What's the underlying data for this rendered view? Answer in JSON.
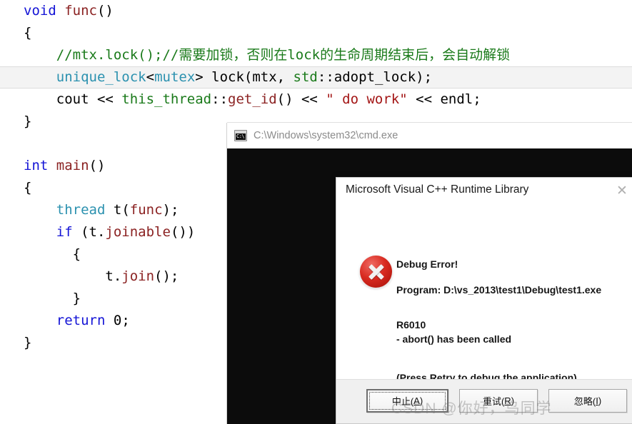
{
  "editor": {
    "name": "code-editor",
    "language": "cpp",
    "lines": [
      {
        "indent": 0,
        "highlighted": false,
        "tokens": [
          {
            "t": "void",
            "c": "kw"
          },
          {
            "t": " ",
            "c": "pl"
          },
          {
            "t": "func",
            "c": "fn"
          },
          {
            "t": "()",
            "c": "pl"
          }
        ]
      },
      {
        "indent": 0,
        "highlighted": false,
        "tokens": [
          {
            "t": "{",
            "c": "pl"
          }
        ]
      },
      {
        "indent": 1,
        "highlighted": false,
        "tokens": [
          {
            "t": "//mtx.lock();//需要加锁，否则在lock的生命周期结束后，会自动解锁",
            "c": "cm"
          }
        ]
      },
      {
        "indent": 1,
        "highlighted": true,
        "tokens": [
          {
            "t": "unique_lock",
            "c": "ty"
          },
          {
            "t": "<",
            "c": "pl"
          },
          {
            "t": "mutex",
            "c": "ty"
          },
          {
            "t": "> lock(mtx, ",
            "c": "pl"
          },
          {
            "t": "std",
            "c": "ns"
          },
          {
            "t": "::adopt_lock);",
            "c": "pl"
          }
        ]
      },
      {
        "indent": 1,
        "highlighted": false,
        "tokens": [
          {
            "t": "cout << ",
            "c": "pl"
          },
          {
            "t": "this_thread",
            "c": "cm"
          },
          {
            "t": "::",
            "c": "pl"
          },
          {
            "t": "get_id",
            "c": "fn"
          },
          {
            "t": "() << ",
            "c": "pl"
          },
          {
            "t": "\" do work\"",
            "c": "st"
          },
          {
            "t": " << endl;",
            "c": "pl"
          }
        ]
      },
      {
        "indent": 0,
        "highlighted": false,
        "tokens": [
          {
            "t": "}",
            "c": "pl"
          }
        ]
      },
      {
        "indent": 0,
        "highlighted": false,
        "tokens": [
          {
            "t": "",
            "c": "pl"
          }
        ]
      },
      {
        "indent": 0,
        "highlighted": false,
        "tokens": [
          {
            "t": "int",
            "c": "kw"
          },
          {
            "t": " ",
            "c": "pl"
          },
          {
            "t": "main",
            "c": "fn"
          },
          {
            "t": "()",
            "c": "pl"
          }
        ]
      },
      {
        "indent": 0,
        "highlighted": false,
        "tokens": [
          {
            "t": "{",
            "c": "pl"
          }
        ]
      },
      {
        "indent": 1,
        "highlighted": false,
        "tokens": [
          {
            "t": "thread",
            "c": "ty"
          },
          {
            "t": " ",
            "c": "pl"
          },
          {
            "t": "t",
            "c": "pl"
          },
          {
            "t": "(",
            "c": "pl"
          },
          {
            "t": "func",
            "c": "fn"
          },
          {
            "t": ");",
            "c": "pl"
          }
        ]
      },
      {
        "indent": 1,
        "highlighted": false,
        "tokens": [
          {
            "t": "if",
            "c": "kw"
          },
          {
            "t": " (t.",
            "c": "pl"
          },
          {
            "t": "joinable",
            "c": "fn"
          },
          {
            "t": "())",
            "c": "pl"
          }
        ]
      },
      {
        "indent": 1,
        "highlighted": false,
        "tokens": [
          {
            "t": "  {",
            "c": "pl"
          }
        ]
      },
      {
        "indent": 2,
        "highlighted": false,
        "tokens": [
          {
            "t": "  t.",
            "c": "pl"
          },
          {
            "t": "join",
            "c": "fn"
          },
          {
            "t": "();",
            "c": "pl"
          }
        ]
      },
      {
        "indent": 1,
        "highlighted": false,
        "tokens": [
          {
            "t": "  }",
            "c": "pl"
          }
        ]
      },
      {
        "indent": 1,
        "highlighted": false,
        "tokens": [
          {
            "t": "return",
            "c": "kw"
          },
          {
            "t": " ",
            "c": "pl"
          },
          {
            "t": "0",
            "c": "pl"
          },
          {
            "t": ";",
            "c": "pl"
          }
        ]
      },
      {
        "indent": 0,
        "highlighted": false,
        "tokens": [
          {
            "t": "}",
            "c": "pl"
          }
        ]
      }
    ],
    "colors": {
      "keyword": "#1414d6",
      "function": "#8b2222",
      "type": "#2b91af",
      "comment": "#1a7a1a",
      "string": "#a31515",
      "plain": "#000000",
      "highlight_band": "#f3f3f3",
      "background": "#ffffff"
    }
  },
  "cmd_window": {
    "title": "C:\\Windows\\system32\\cmd.exe",
    "icon": "cmd-console-icon",
    "console_text": "",
    "background": "#0c0c0c",
    "titlebar_background": "#ffffff"
  },
  "dialog": {
    "title": "Microsoft Visual C++ Runtime Library",
    "close_label": "✕",
    "icon": "error-x-icon",
    "heading": "Debug Error!",
    "program_line": "Program: D:\\vs_2013\\test1\\Debug\\test1.exe",
    "error_code": "R6010",
    "error_detail": "- abort() has been called",
    "retry_hint": "(Press Retry to debug the application)",
    "buttons": [
      {
        "name": "abort-button",
        "text_prefix": "中止(",
        "accel": "A",
        "text_suffix": ")",
        "focused": true
      },
      {
        "name": "retry-button",
        "text_prefix": "重试(",
        "accel": "R",
        "text_suffix": ")",
        "focused": false
      },
      {
        "name": "ignore-button",
        "text_prefix": "忽略(",
        "accel": "I",
        "text_suffix": ")",
        "focused": false
      }
    ],
    "colors": {
      "error_red": "#d92b21",
      "buttonbar_background": "#f0f0f0",
      "dialog_background": "#ffffff"
    }
  },
  "watermark": {
    "text": "CSDN @你好，鸟同学"
  }
}
